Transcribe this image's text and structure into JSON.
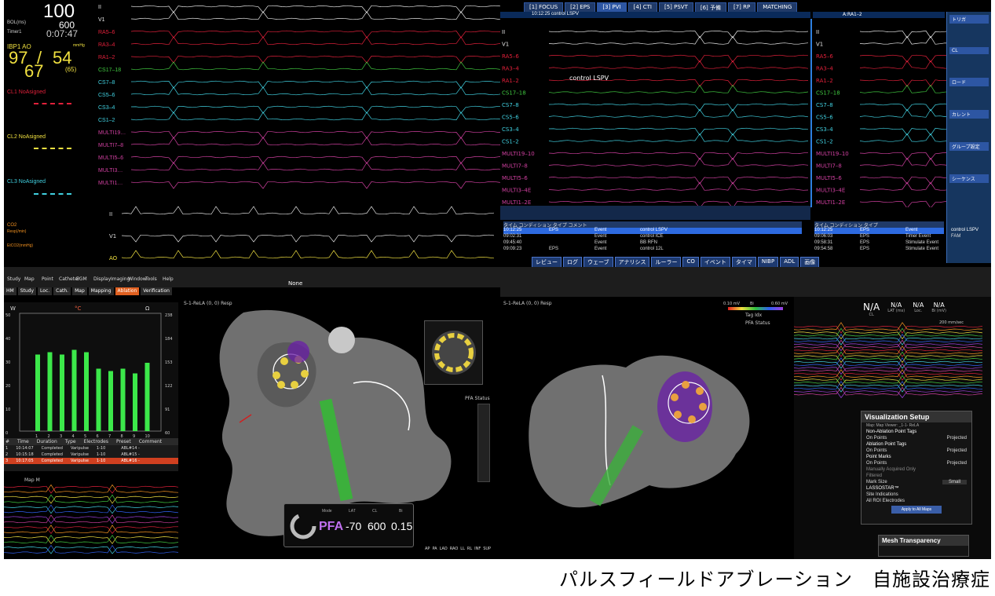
{
  "vitals": {
    "hr_value": "100",
    "hr_sub": "600",
    "timer": "0:07:47",
    "bol_label": "BOL(ms)",
    "timer_label": "Timer1",
    "ibp_label": "IBP1 AO",
    "ibp_unit": "mmHg",
    "sys_top": "97",
    "dia_top": "54",
    "sys_bottom": "67",
    "map_bottom": "(65)",
    "cl1": "CL1  NoAsigned",
    "cl2": "CL2  NoAsigned",
    "cl3": "CL3  NoAsigned",
    "co2": "CO2",
    "co2_sub": "Resp(/min)",
    "etco2": "EtCO2(mmHg)"
  },
  "ecg_left_channels": [
    "II",
    "V1",
    "RA5–6",
    "RA3–4",
    "RA1–2",
    "CS17–18",
    "CS7–8",
    "CS5–6",
    "CS3–4",
    "CS1–2",
    "MULTI19…",
    "MULTI7–8",
    "MULTI5–6",
    "MULTI3…",
    "MULTI1…"
  ],
  "ecg_bottom_labels": [
    "II",
    "V1",
    "AO"
  ],
  "ecg_right_tabs": [
    "[1] FOCUS",
    "[2] EPS",
    "[3] PVI",
    "[4] CTI",
    "[5] PSVT",
    "[6] 予備",
    "[7] RP",
    "MATCHING"
  ],
  "ecg_right_header": "10:12:25 control LSPV",
  "ecg_right_channels": [
    "II",
    "V1",
    "RA5–6",
    "RA3–4",
    "RA1–2",
    "CS17–18",
    "CS7–8",
    "CS5–6",
    "CS3–4",
    "CS1–2",
    "MULTI19–10",
    "MULTI7–8",
    "MULTI5–6",
    "MULTI3–4E",
    "MULTI1–2E"
  ],
  "ecg_mid_label": "control LSPV",
  "ecg_far_header": "A:RA1–2",
  "ecg_far_channels": [
    "II",
    "V1",
    "RA5–6",
    "RA3–4",
    "RA1–2",
    "CS17–18",
    "CS7–8",
    "CS5–6",
    "CS3–4",
    "CS1–2",
    "MULTI19–10",
    "MULTI7–8",
    "MULTI5–6",
    "MULTI3–4E",
    "MULTI1–2E"
  ],
  "side_menu": [
    "トリガ",
    "CL",
    "ロード",
    "カレント",
    "グループ設定",
    "シーケンス"
  ],
  "event_table_left": {
    "headers": [
      "タイム",
      "コンディション",
      "タイプ",
      "コメント"
    ],
    "rows": [
      [
        "10:12:25",
        "EPS",
        "Event",
        "control LSPV"
      ],
      [
        "09:02:31",
        "",
        "Event",
        "control ICE"
      ],
      [
        "09:45:40",
        "",
        "Event",
        "BB RFN"
      ],
      [
        "09:09:23",
        "EPS",
        "Event",
        "control 12L"
      ]
    ]
  },
  "event_table_right": {
    "headers": [
      "タイム",
      "コンディション",
      "タイプ"
    ],
    "rows": [
      [
        "10:12:25",
        "EPS",
        "Event",
        "control LSPV"
      ],
      [
        "09:06:03",
        "EPS",
        "Timer Event",
        "FAM"
      ],
      [
        "09:58:31",
        "EPS",
        "Stimulate Event",
        ""
      ],
      [
        "09:54:58",
        "EPS",
        "Stimulate Event",
        ""
      ]
    ]
  },
  "bottom_buttons": [
    "レビュー",
    "ログ",
    "ウェーブ",
    "アナリシス",
    "ルーラー",
    "CO",
    "イベント",
    "タイマ",
    "NIBP",
    "ADL",
    "画像"
  ],
  "left3d": {
    "menu": [
      "Study",
      "Map",
      "Point",
      "Catheter",
      "EGM",
      "Display",
      "Imaging",
      "Window",
      "Tools",
      "Help"
    ],
    "tabs": [
      "HM",
      "Study",
      "Loc.",
      "Cath.",
      "Map",
      "Mapping",
      "Ablation",
      "Verification"
    ],
    "view_label": "S-1-ReLA (0, 0) Resp",
    "chart_units": [
      "W",
      "°C",
      "Ω"
    ],
    "yaxis_left": [
      "50",
      "40",
      "30",
      "20",
      "10",
      "0"
    ],
    "yaxis_right": [
      "238",
      "184",
      "153",
      "122",
      "91",
      "60"
    ],
    "table_headers": [
      "#",
      "Time",
      "Duration",
      "Type",
      "Electrodes",
      "Preset",
      "Comment"
    ],
    "table_rows": [
      [
        "1",
        "10:14:07",
        "Completed",
        "Varipulse",
        "1-10",
        "",
        "ABL#14 -"
      ],
      [
        "2",
        "10:15:18",
        "Completed",
        "Varipulse",
        "1-10",
        "",
        "ABL#15 -"
      ],
      [
        "3",
        "10:17:05",
        "Completed",
        "Varipulse",
        "1-10",
        "",
        "ABL#16 -"
      ]
    ],
    "map_label": "Map M",
    "pfa_mode_label": "Mode",
    "pfa_mode": "PFA",
    "lat_label": "LAT",
    "lat": "-70",
    "cl_label": "CL",
    "cl": "600",
    "bi_label": "Bi",
    "bi": "0.15",
    "pfa_status": "PFA Status",
    "none_label": "None",
    "orient": "PA",
    "view_buttons": [
      "AP",
      "PA",
      "LAO",
      "RAO",
      "LL",
      "RL",
      "INF",
      "SUP"
    ]
  },
  "right3d": {
    "view_label": "S-1-ReLA (0, 0) Resp",
    "legend_a": "0.10 mV",
    "legend_b": "Bi",
    "legend_c": "0.60 mV",
    "legend_tags": "Tag Idx",
    "legend_pfa": "PFA Status",
    "na_values": [
      "N/A",
      "N/A",
      "N/A",
      "N/A"
    ],
    "na_labels": [
      "CL",
      "LAT (ms)",
      "Loc.",
      "Bi (mV)"
    ],
    "speed": "200 mm/sec",
    "none_label": "None"
  },
  "vis_setup": {
    "title": "Visualization Setup",
    "subtitle": "Map: Map Viewer: _1-1- ReLA",
    "sec1": "Non-Ablation Point Tags",
    "sec2": "Ablation Point Tags",
    "sec3": "Point Marks",
    "on_points": "On Points",
    "projected": "Projected",
    "manually": "Manually Acquired Only",
    "filtered": "Filtered",
    "mark_size": "Mark Size",
    "small": "Small",
    "lasso": "LASSOSTAR™",
    "site_ind": "Site Indications",
    "all_roi": "All ROI Electrodes",
    "apply": "Apply to All Maps",
    "mesh": "Mesh Transparency"
  },
  "caption": "パルスフィールドアブレーション　自施設治療症例",
  "colors": {
    "ecg_red": "#e0203a",
    "ecg_green": "#40c840",
    "ecg_cyan": "#40d0e0",
    "ecg_magenta": "#d040a0",
    "yellow": "#f0e040",
    "bar_green": "#3ce84a"
  }
}
